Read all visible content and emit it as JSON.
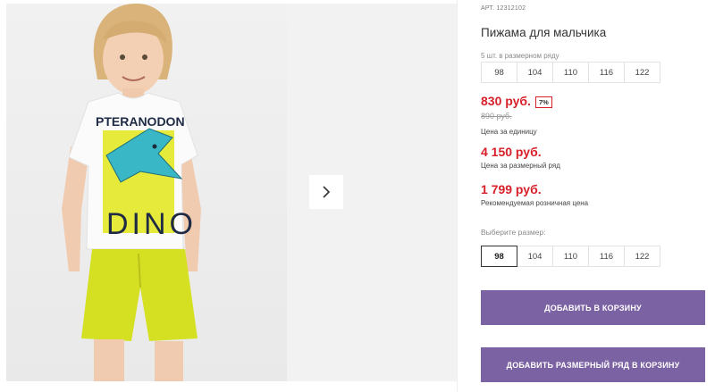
{
  "gallery": {
    "shirt_text_top": "PTERANODON",
    "shirt_text_bottom": "DINO",
    "next_icon": "chevron-right-icon"
  },
  "product": {
    "article": "АРТ. 12312102",
    "title": "Пижама для мальчика",
    "pack_label": "5 шт. в размерном ряду",
    "pack_sizes": [
      "98",
      "104",
      "110",
      "116",
      "122"
    ],
    "price_unit": "830 руб.",
    "discount_badge": "7%",
    "old_price": "890 руб.",
    "price_unit_note": "Цена за единицу",
    "price_pack": "4 150 руб.",
    "price_pack_note": "Цена за размерный ряд",
    "price_rrp": "1 799 руб.",
    "price_rrp_note": "Рекомендуемая розничная цена",
    "choose_size_label": "Выберите размер:",
    "sizes": [
      "98",
      "104",
      "110",
      "116",
      "122"
    ],
    "selected_size": "98"
  },
  "actions": {
    "add_to_cart": "ДОБАВИТЬ В КОРЗИНУ",
    "add_pack_to_cart": "ДОБАВИТЬ РАЗМЕРНЫЙ РЯД В КОРЗИНУ"
  },
  "colors": {
    "accent": "#7b62a3",
    "price_red": "#d8202a",
    "shorts_lime": "#d4e021"
  }
}
